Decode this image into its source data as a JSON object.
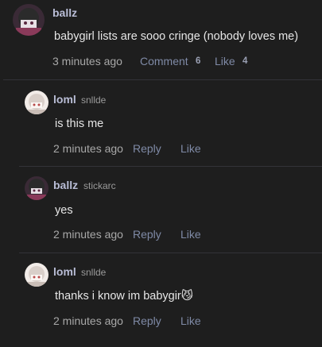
{
  "post": {
    "username": "ballz",
    "text": "babygirl lists are sooo cringe (nobody loves me)",
    "time": "3 minutes ago",
    "comment_label": "Comment",
    "comment_count": "6",
    "like_label": "Like",
    "like_count": "4"
  },
  "replies": [
    {
      "username": "loml",
      "handle": "snllde",
      "text": "is this me",
      "time": "2 minutes ago",
      "reply_label": "Reply",
      "like_label": "Like"
    },
    {
      "username": "ballz",
      "handle": "stickarc",
      "text": "yes",
      "time": "2 minutes ago",
      "reply_label": "Reply",
      "like_label": "Like"
    },
    {
      "username": "loml",
      "handle": "snllde",
      "text": "thanks i know im babygir😼",
      "time": "2 minutes ago",
      "reply_label": "Reply",
      "like_label": "Like"
    }
  ]
}
